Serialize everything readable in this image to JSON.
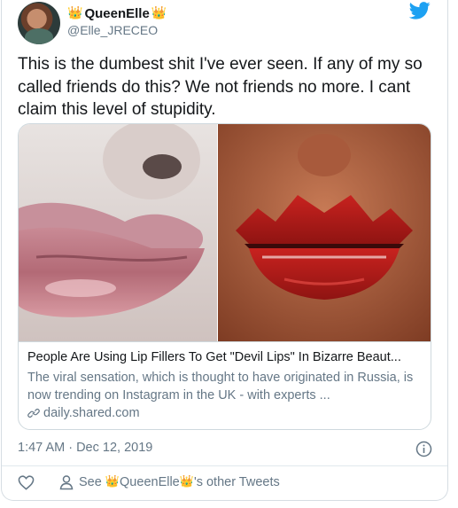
{
  "user": {
    "display_name": "QueenElle",
    "crown_glyph": "👑",
    "handle": "@Elle_JRECEO"
  },
  "tweet": {
    "text": "This is the dumbest shit I've ever seen. If any of my so called friends do this? We not friends no more. I cant claim this level of stupidity."
  },
  "link_card": {
    "title": "People Are Using Lip Fillers To Get \"Devil Lips\" In Bizarre Beaut...",
    "description": "The viral sensation, which is thought to have originated in Russia, is now trending on Instagram in the UK - with experts ...",
    "domain": "daily.shared.com"
  },
  "timestamp": "1:47 AM · Dec 12, 2019",
  "footer": {
    "see_label": "See",
    "other_tweets_label": "'s other Tweets"
  },
  "colors": {
    "twitter_blue": "#1da1f2",
    "secondary_text": "#657786",
    "crown": "#f2b400"
  },
  "icons": [
    "twitter-bird-icon",
    "link-icon",
    "info-icon",
    "heart-icon",
    "person-icon"
  ]
}
